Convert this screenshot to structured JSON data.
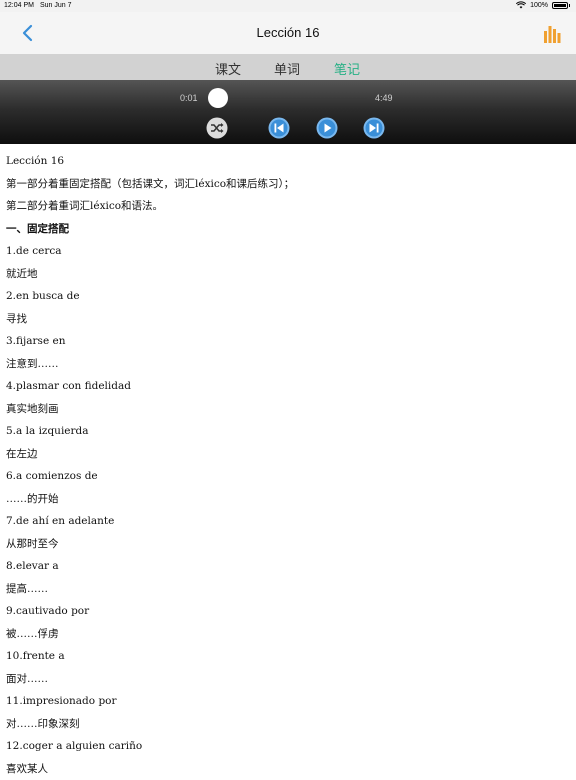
{
  "status_bar": {
    "time": "12:04 PM",
    "date": "Sun Jun 7",
    "battery": "100%",
    "wifi_icon": "wifi-icon",
    "battery_icon": "battery-icon"
  },
  "nav": {
    "title": "Lección 16",
    "back_icon": "chevron-left-icon",
    "right_icon": "bar-chart-icon",
    "accent": "#f0a030"
  },
  "tabs": [
    {
      "label": "课文",
      "active": false
    },
    {
      "label": "单词",
      "active": false
    },
    {
      "label": "笔记",
      "active": true
    }
  ],
  "tab_accent": "#27b085",
  "player": {
    "current_time": "0:01",
    "total_time": "4:49",
    "progress": 0.0035,
    "controls": [
      "shuffle-icon",
      "previous-icon",
      "play-icon",
      "next-icon"
    ],
    "button_color": "#3a8fd8"
  },
  "content": {
    "lines": [
      {
        "text": "Lección 16",
        "bold": false
      },
      {
        "text": "第一部分着重固定搭配（包括课文，词汇léxico和课后练习）；",
        "bold": false
      },
      {
        "text": "第二部分着重词汇léxico和语法。",
        "bold": false
      },
      {
        "text": "一、固定搭配",
        "bold": true
      },
      {
        "text": "1.de cerca",
        "bold": false
      },
      {
        "text": "就近地",
        "bold": false
      },
      {
        "text": "2.en busca de",
        "bold": false
      },
      {
        "text": "寻找",
        "bold": false
      },
      {
        "text": "3.fijarse en",
        "bold": false
      },
      {
        "text": "注意到……",
        "bold": false
      },
      {
        "text": "4.plasmar con fidelidad",
        "bold": false
      },
      {
        "text": "真实地刻画",
        "bold": false
      },
      {
        "text": "5.a la izquierda",
        "bold": false
      },
      {
        "text": "在左边",
        "bold": false
      },
      {
        "text": "6.a comienzos de",
        "bold": false
      },
      {
        "text": "……的开始",
        "bold": false
      },
      {
        "text": "7.de ahí en adelante",
        "bold": false
      },
      {
        "text": "从那时至今",
        "bold": false
      },
      {
        "text": "8.elevar a",
        "bold": false
      },
      {
        "text": "提高……",
        "bold": false
      },
      {
        "text": "9.cautivado por",
        "bold": false
      },
      {
        "text": "被……俘虏",
        "bold": false
      },
      {
        "text": "10.frente a",
        "bold": false
      },
      {
        "text": "面对……",
        "bold": false
      },
      {
        "text": "11.impresionado por",
        "bold": false
      },
      {
        "text": "对……印象深刻",
        "bold": false
      },
      {
        "text": "12.coger a alguien cariño",
        "bold": false
      },
      {
        "text": "喜欢某人",
        "bold": false
      }
    ]
  }
}
